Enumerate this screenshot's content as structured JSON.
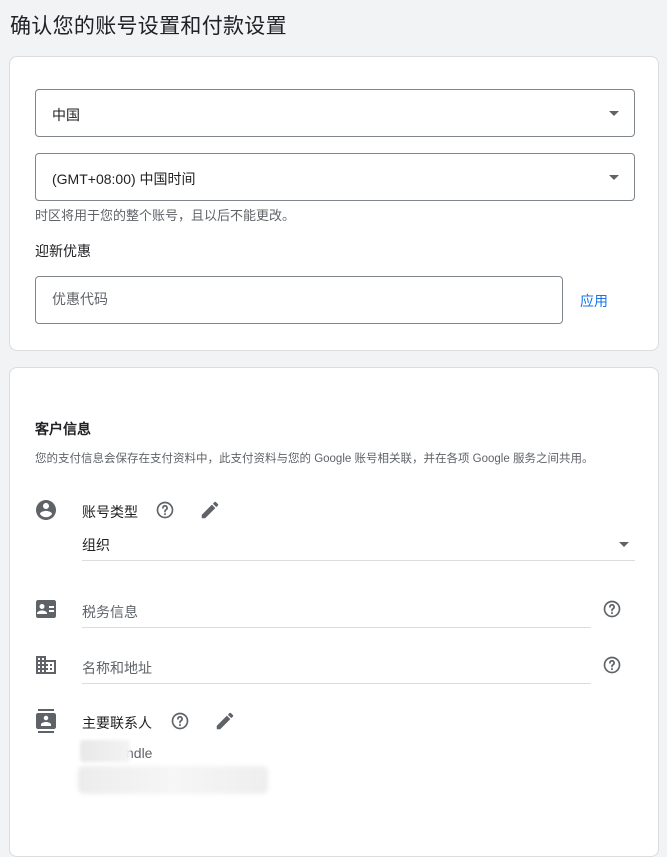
{
  "page": {
    "title": "确认您的账号设置和付款设置"
  },
  "account_settings": {
    "country": {
      "value": "中国"
    },
    "timezone": {
      "value": "(GMT+08:00) 中国时间",
      "hint": "时区将用于您的整个账号，且以后不能更改。"
    },
    "promo": {
      "label": "迎新优惠",
      "placeholder": "优惠代码",
      "apply_label": "应用"
    }
  },
  "customer_info": {
    "title": "客户信息",
    "description": "您的支付信息会保存在支付资料中，此支付资料与您的 Google 账号相关联，并在各项 Google 服务之间共用。",
    "account_type": {
      "label": "账号类型",
      "value": "组织"
    },
    "tax_info": {
      "placeholder": "税务信息"
    },
    "name_address": {
      "placeholder": "名称和地址"
    },
    "primary_contact": {
      "label": "主要联系人",
      "name_visible": "ndle"
    }
  },
  "colors": {
    "accent": "#1a73e8",
    "icon": "#5f6368",
    "border": "#dadce0"
  },
  "icons": [
    "account-circle-icon",
    "help-icon",
    "edit-icon",
    "contact-card-icon",
    "building-icon",
    "contacts-book-icon",
    "dropdown-arrow-icon"
  ]
}
